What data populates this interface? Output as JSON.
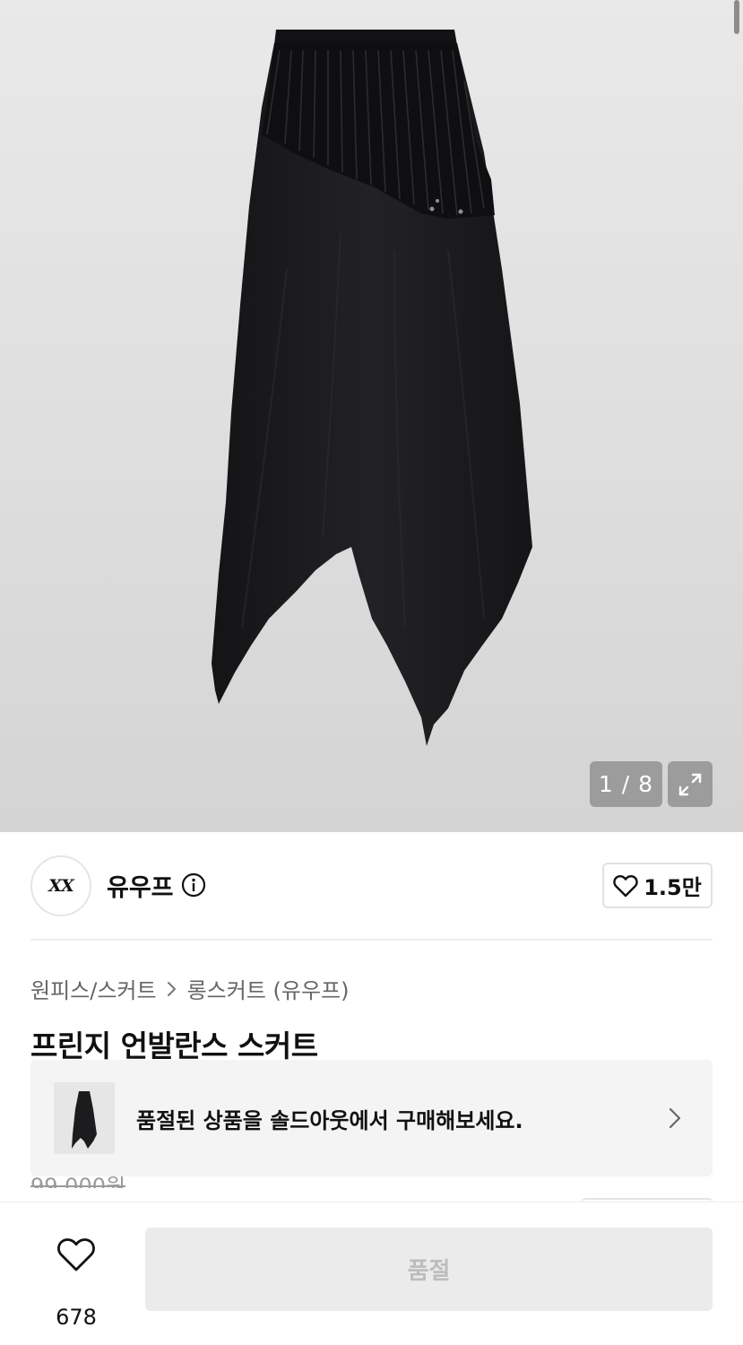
{
  "gallery": {
    "counter": "1 / 8",
    "image_icon": "expand-icon"
  },
  "brand": {
    "logo_text": "XX",
    "name": "유우프",
    "info_icon": "info-icon",
    "like_count": "1.5만"
  },
  "breadcrumb": {
    "category": "원피스/스커트",
    "subcategory": "롱스커트 (유우프)"
  },
  "product": {
    "title": "프린지 언발란스 스커트",
    "original_price": "99,000원"
  },
  "soldout_banner": {
    "text": "품절된 상품을 솔드아웃에서 구매해보세요."
  },
  "bottom_bar": {
    "wish_count": "678",
    "action_label": "품절"
  },
  "colors": {
    "skirt": "#1c1c1e",
    "disabled_button": "#ebebeb",
    "disabled_text": "#bdbdbd"
  }
}
